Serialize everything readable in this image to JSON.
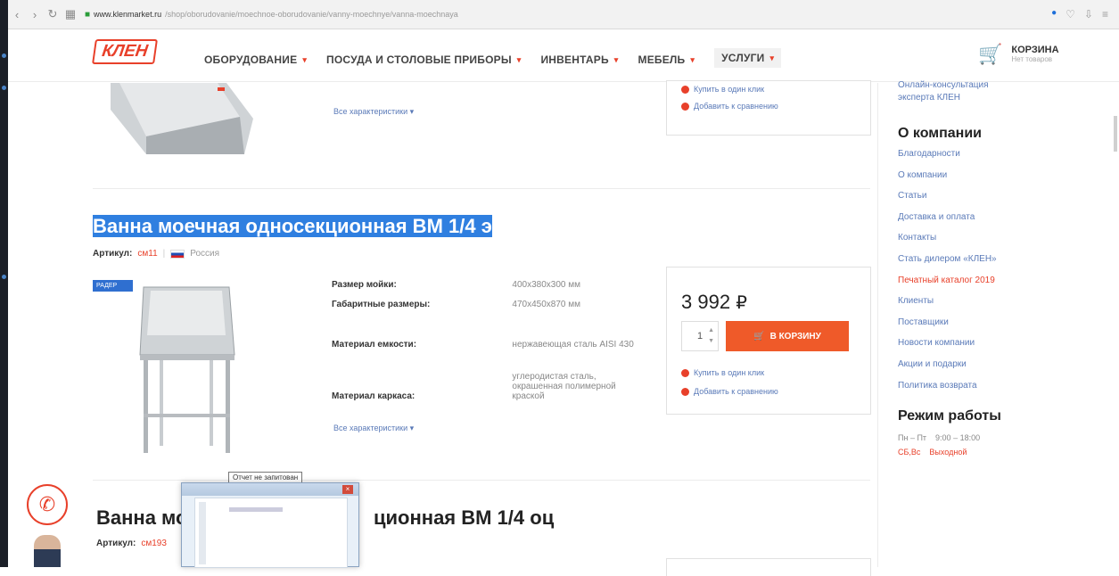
{
  "browser": {
    "url_host": "www.klenmarket.ru",
    "url_path": "/shop/oborudovanie/moechnoe-oborudovanie/vanny-moechnye/vanna-moechnaya"
  },
  "header": {
    "logo": "КЛЕН",
    "nav": [
      "ОБОРУДОВАНИЕ",
      "ПОСУДА И СТОЛОВЫЕ ПРИБОРЫ",
      "ИНВЕНТАРЬ",
      "МЕБЕЛЬ",
      "УСЛУГИ"
    ],
    "cart_title": "КОРЗИНА",
    "cart_sub": "Нет товаров"
  },
  "product_top": {
    "all_specs": "Все характеристики",
    "buy_one_click": "Купить в один клик",
    "compare": "Добавить к сравнению"
  },
  "product1": {
    "title": "Ванна моечная односекционная ВМ 1/4 э",
    "article_label": "Артикул:",
    "article": "см11",
    "country": "Россия",
    "badge": "РАДЕР",
    "specs": [
      {
        "k": "Размер мойки:",
        "v": "400х380х300 мм"
      },
      {
        "k": "Габаритные размеры:",
        "v": "470х450х870 мм"
      },
      {
        "k": "Материал емкости:",
        "v": "нержавеющая сталь AISI 430"
      },
      {
        "k": "Материал каркаса:",
        "v": "углеродистая сталь, окрашенная полимерной краской"
      }
    ],
    "all_specs": "Все характеристики",
    "price": "3 992",
    "currency": "₽",
    "qty": "1",
    "buy_label": "В КОРЗИНУ",
    "buy_one_click": "Купить в один клик",
    "compare": "Добавить к сравнению"
  },
  "product2": {
    "title_left": "Ванна мо",
    "title_right": "ционная ВМ 1/4 оц",
    "article_label": "Артикул:",
    "article": "см193"
  },
  "sidebar": {
    "top_link": "Онлайн-консультация эксперта КЛЕН",
    "about_title": "О компании",
    "links": [
      {
        "label": "Благодарности",
        "red": false
      },
      {
        "label": "О компании",
        "red": false
      },
      {
        "label": "Статьи",
        "red": false
      },
      {
        "label": "Доставка и оплата",
        "red": false
      },
      {
        "label": "Контакты",
        "red": false
      },
      {
        "label": "Стать дилером «КЛЕН»",
        "red": false
      },
      {
        "label": "Печатный каталог 2019",
        "red": true
      },
      {
        "label": "Клиенты",
        "red": false
      },
      {
        "label": "Поставщики",
        "red": false
      },
      {
        "label": "Новости компании",
        "red": false
      },
      {
        "label": "Акции и подарки",
        "red": false
      },
      {
        "label": "Политика возврата",
        "red": false
      }
    ],
    "hours_title": "Режим работы",
    "hours": [
      {
        "days": "Пн – Пт",
        "time": "9:00 – 18:00"
      },
      {
        "days": "СБ,Вс",
        "time": "Выходной"
      }
    ]
  },
  "overlay": {
    "tooltip": "Отчет не запитован"
  }
}
